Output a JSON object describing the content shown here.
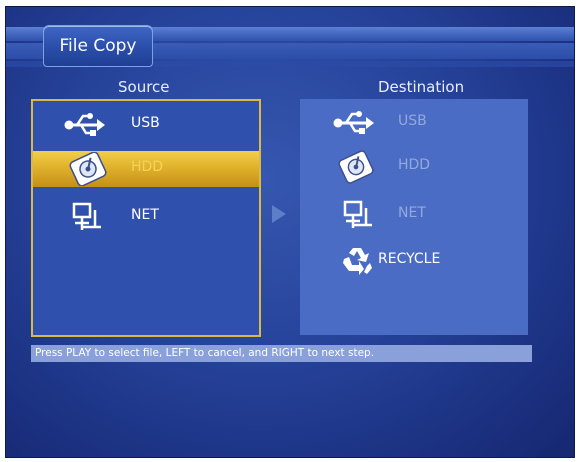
{
  "window": {
    "title": "File Copy"
  },
  "source": {
    "label": "Source",
    "items": [
      {
        "label": "USB",
        "icon": "usb-icon"
      },
      {
        "label": "HDD",
        "icon": "hdd-icon",
        "selected": true
      },
      {
        "label": "NET",
        "icon": "network-icon"
      }
    ]
  },
  "destination": {
    "label": "Destination",
    "items": [
      {
        "label": "USB",
        "icon": "usb-icon",
        "enabled": false
      },
      {
        "label": "HDD",
        "icon": "hdd-icon",
        "enabled": false
      },
      {
        "label": "NET",
        "icon": "network-icon",
        "enabled": false
      },
      {
        "label": "RECYCLE",
        "icon": "recycle-icon",
        "enabled": true
      }
    ]
  },
  "hint": "Press PLAY to select file, LEFT to cancel, and RIGHT to next step.",
  "colors": {
    "background": "#26439a",
    "selection": "#e0b22c",
    "source_border": "#d8b94a",
    "dest_panel": "#4b6cc4",
    "hint_bar": "#8aa0da"
  }
}
